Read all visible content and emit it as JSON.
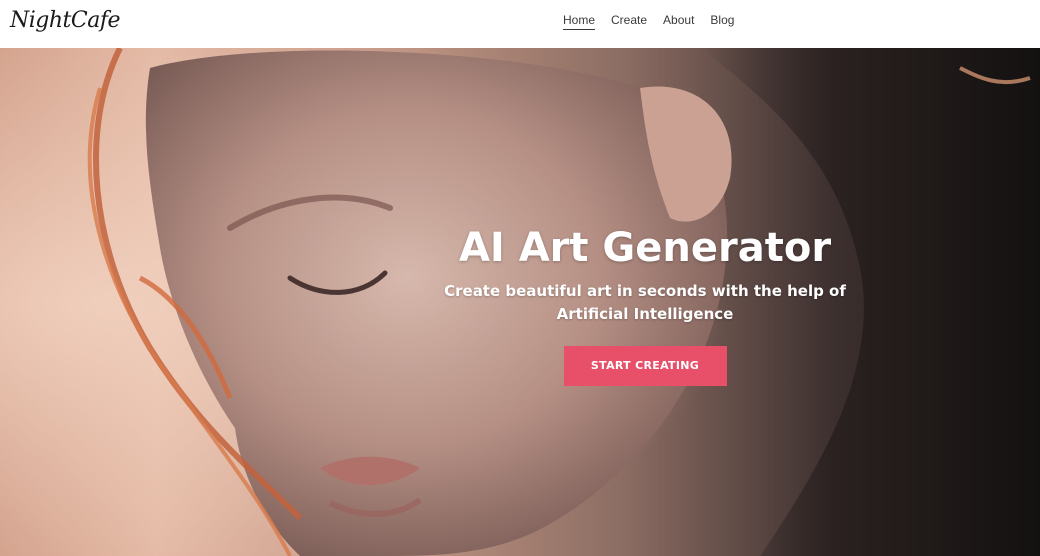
{
  "header": {
    "logo": "NightCafe",
    "nav": [
      {
        "label": "Home",
        "active": true
      },
      {
        "label": "Create",
        "active": false
      },
      {
        "label": "About",
        "active": false
      },
      {
        "label": "Blog",
        "active": false
      }
    ]
  },
  "hero": {
    "title": "AI Art Generator",
    "subtitle": "Create beautiful art in seconds with the help of Artificial Intelligence",
    "cta_label": "START CREATING",
    "background_image": "ai-generated-portrait-of-woman-with-closed-eyes-and-red-hair"
  },
  "colors": {
    "accent": "#e8506a",
    "header_bg": "#ffffff",
    "nav_text": "#3a3a3a",
    "hero_text": "#ffffff"
  }
}
